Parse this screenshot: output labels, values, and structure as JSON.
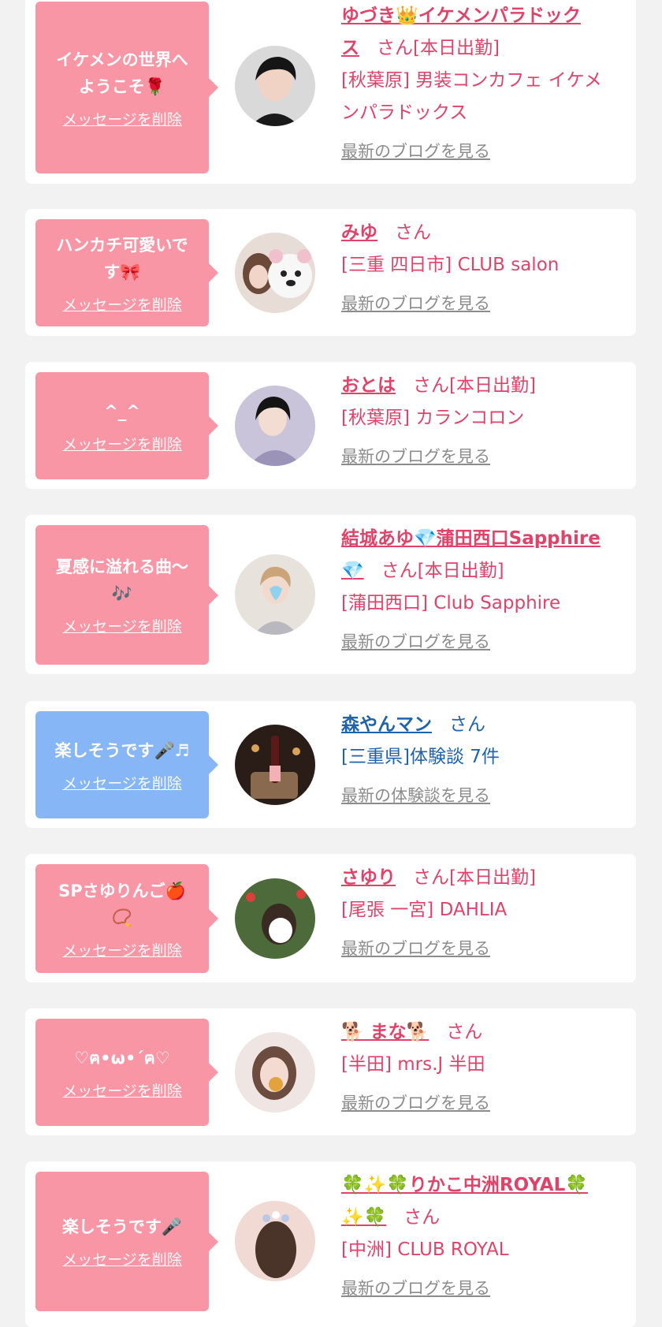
{
  "common": {
    "delete_label": "メッセージを削除",
    "san": "さん",
    "on_duty": "[本日出勤]"
  },
  "items": [
    {
      "message": "イケメンの世界へようこそ🌹",
      "name": "ゆづき👑イケメンパラドックス",
      "name_lines": [
        "ゆづき👑イケメンパラドック",
        "ス"
      ],
      "suffix": "さん[本日出勤]",
      "shop_lines": [
        "[秋葉原] 男装コンカフェ イケメ",
        "ンパラドックス"
      ],
      "link": "最新のブログを見る",
      "theme": "pink"
    },
    {
      "message_lines": [
        "ハンカチ可愛いで",
        "す🎀"
      ],
      "name_lines": [
        "みゆ"
      ],
      "suffix": "さん",
      "shop_lines": [
        "[三重 四日市] CLUB salon"
      ],
      "link": "最新のブログを見る",
      "theme": "pink"
    },
    {
      "message_lines": [
        "^_^"
      ],
      "name_lines": [
        "おとは"
      ],
      "suffix": "さん[本日出勤]",
      "shop_lines": [
        "[秋葉原] カランコロン"
      ],
      "link": "最新のブログを見る",
      "theme": "pink"
    },
    {
      "message_lines": [
        "夏感に溢れる曲〜",
        "🎶"
      ],
      "name_lines": [
        "結城あゆ💎蒲田西口Sapphire",
        "💎"
      ],
      "suffix": "さん[本日出勤]",
      "shop_lines": [
        "[蒲田西口] Club Sapphire"
      ],
      "link": "最新のブログを見る",
      "theme": "pink"
    },
    {
      "message_lines": [
        "楽しそうです🎤♬"
      ],
      "name_lines": [
        "森やんマン"
      ],
      "suffix": "さん",
      "shop_lines": [
        "[三重県]体験談 7件"
      ],
      "link": "最新の体験談を見る",
      "theme": "blue"
    },
    {
      "message_lines": [
        "SPさゆりんご🍎",
        "📿"
      ],
      "name_lines": [
        "さゆり"
      ],
      "suffix": "さん[本日出勤]",
      "shop_lines": [
        "[尾張 一宮] DAHLIA"
      ],
      "link": "最新のブログを見る",
      "theme": "pink"
    },
    {
      "message_lines": [
        "♡ฅ•ω•´ฅ♡"
      ],
      "name_lines": [
        "🐕 まな🐕"
      ],
      "suffix": "さん",
      "shop_lines": [
        "[半田] mrs.J 半田"
      ],
      "link": "最新のブログを見る",
      "theme": "pink"
    },
    {
      "message_lines": [
        "楽しそうです🎤"
      ],
      "name_lines": [
        "🍀✨🍀りかこ中洲ROYAL🍀",
        "✨🍀"
      ],
      "suffix": "さん",
      "shop_lines": [
        "[中洲] CLUB ROYAL"
      ],
      "link": "最新のブログを見る",
      "theme": "pink"
    }
  ],
  "colors": {
    "page_bg": "#f2f2f2",
    "pink_bubble": "#f996a6",
    "blue_bubble": "#86b6f5",
    "name_pink": "#e0436a",
    "name_blue": "#1f63ad",
    "link_gray": "#8c8c8c"
  }
}
